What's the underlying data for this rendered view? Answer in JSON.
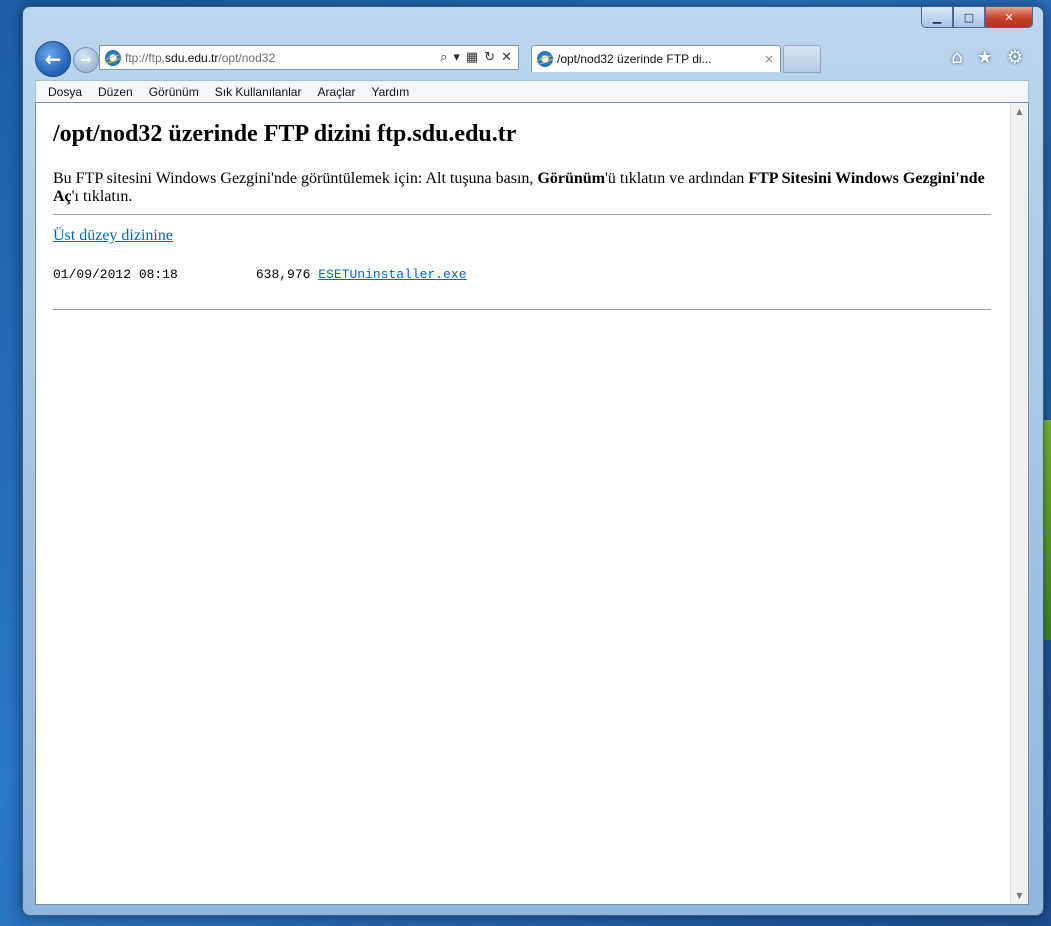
{
  "browser": {
    "address_url_prefix": "ftp://ftp.",
    "address_url_host": "sdu.edu.tr",
    "address_url_path": "/opt/nod32",
    "tab_title": "/opt/nod32 üzerinde FTP di...",
    "tab_close": "×"
  },
  "menu": [
    "Dosya",
    "Düzen",
    "Görünüm",
    "Sık Kullanılanlar",
    "Araçlar",
    "Yardım"
  ],
  "page": {
    "heading": "/opt/nod32 üzerinde FTP dizini ftp.sdu.edu.tr",
    "instr_part1": "Bu FTP sitesini Windows Gezgini'nde görüntülemek için: Alt tuşuna basın, ",
    "instr_bold1": "Görünüm",
    "instr_part2": "'ü tıklatın ve ardından ",
    "instr_bold2": "FTP Sitesini Windows Gezgini'nde Aç",
    "instr_part3": "'ı tıklatın.",
    "up_link": "Üst düzey dizinine",
    "files": [
      {
        "date": "01/09/2012 08:18",
        "size": "638,976",
        "name": "ESETUninstaller.exe"
      }
    ]
  },
  "icons": {
    "back": "←",
    "forward": "→",
    "search": "⌕",
    "dropdown": "▾",
    "compat": "▦",
    "refresh": "↻",
    "stop": "✕",
    "home": "⌂",
    "favorites": "★",
    "tools": "⚙",
    "minimize": "▁",
    "maximize": "□",
    "close": "✕",
    "scroll_up": "▲",
    "scroll_down": "▼"
  }
}
